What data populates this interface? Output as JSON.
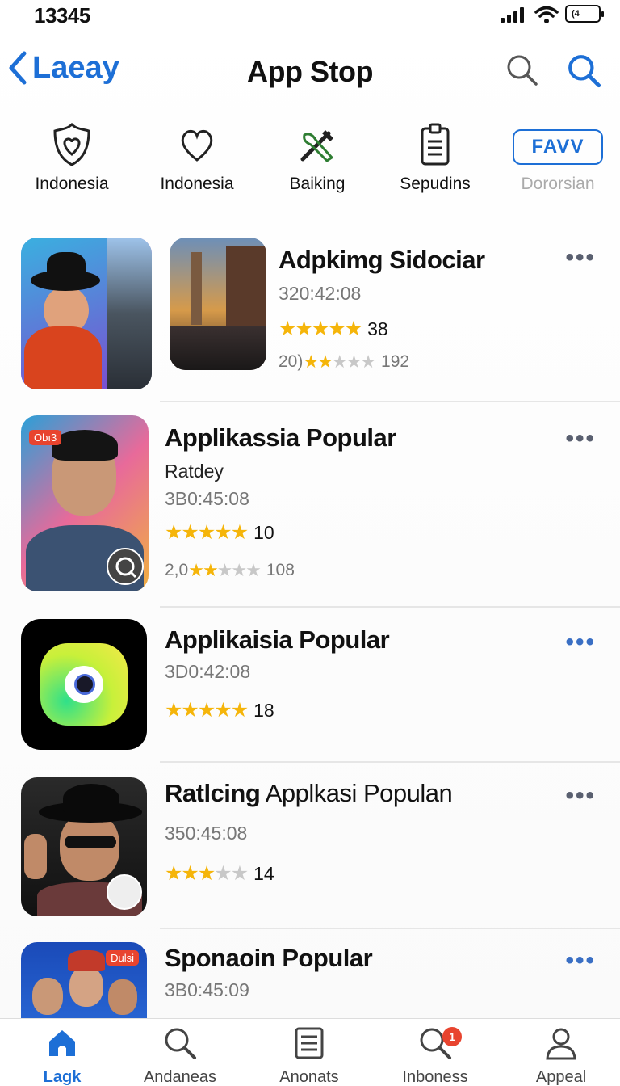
{
  "status_bar": {
    "time": "13345",
    "battery_label": "(4"
  },
  "nav": {
    "back_label": "Laeay",
    "title": "App Stop"
  },
  "categories": [
    {
      "label": "Indonesia",
      "icon": "shield-heart-icon"
    },
    {
      "label": "Indonesia",
      "icon": "heart-icon"
    },
    {
      "label": "Baiking",
      "icon": "tools-icon"
    },
    {
      "label": "Sepudins",
      "icon": "clipboard-icon"
    },
    {
      "label": "Dororsian",
      "button": "FAVV"
    }
  ],
  "apps": [
    {
      "title": "Adpkimg Sidociar",
      "meta": "320:42:08",
      "rating": 4.5,
      "rating_count": "38",
      "sub_prefix": "20)",
      "sub_rating": 2,
      "sub_count": "192"
    },
    {
      "title": "Applikassia Popular",
      "subtitle": "Ratdey",
      "meta": "3B0:45:08",
      "rating": 4.5,
      "rating_count": "10",
      "sub_prefix": "2,0",
      "sub_rating": 2,
      "sub_count": "108",
      "thumb_badge": "Obı3"
    },
    {
      "title": "Applikaisia Popular",
      "meta": "3D0:42:08",
      "rating": 4.5,
      "rating_count": "18"
    },
    {
      "title_bold": "Ratlcing",
      "title_rest": "Applkasi Populan",
      "meta": "350:45:08",
      "rating": 3,
      "rating_count": "14"
    },
    {
      "title": "Sponaoin Popular",
      "meta": "3B0:45:09",
      "thumb_badge": "Dulsi"
    }
  ],
  "tabs": [
    {
      "label": "Lagk",
      "icon": "home-icon",
      "active": true
    },
    {
      "label": "Andaneas",
      "icon": "search-icon"
    },
    {
      "label": "Anonats",
      "icon": "document-icon"
    },
    {
      "label": "Inboness",
      "icon": "search-badge-icon",
      "badge": "1"
    },
    {
      "label": "Appeal",
      "icon": "person-icon"
    }
  ],
  "colors": {
    "accent": "#1d6fd6",
    "star": "#f5b50a",
    "badge": "#e8442f"
  }
}
